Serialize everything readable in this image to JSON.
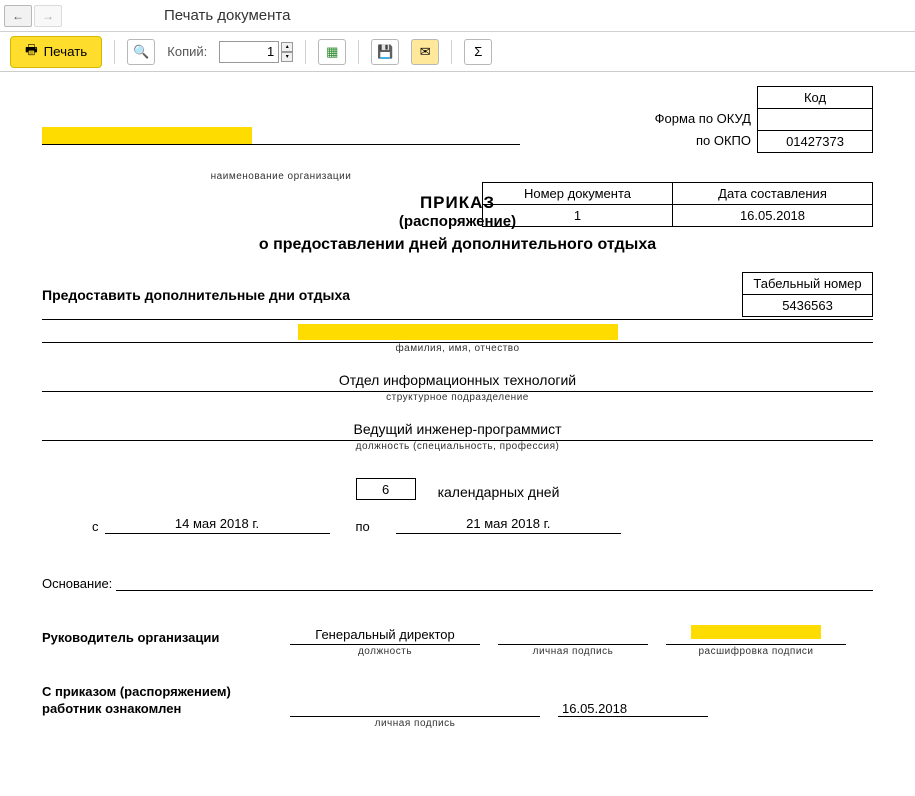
{
  "window": {
    "title": "Печать документа"
  },
  "toolbar": {
    "print": "Печать",
    "copies_label": "Копий:",
    "copies_value": "1"
  },
  "form": {
    "okud_label": "Форма по ОКУД",
    "okpo_label": "по ОКПО",
    "code_header": "Код",
    "okud_value": "",
    "okpo_value": "01427373",
    "org_caption": "наименование организации",
    "num_header": "Номер документа",
    "date_header": "Дата составления",
    "doc_number": "1",
    "doc_date": "16.05.2018",
    "title1": "ПРИКАЗ",
    "title2": "(распоряжение)",
    "title3": "о предоставлении дней дополнительного отдыха",
    "grant_text": "Предоставить дополнительные дни отдыха",
    "tab_header": "Табельный номер",
    "tab_value": "5436563",
    "fio_caption": "фамилия, имя, отчество",
    "dept_value": "Отдел информационных технологий",
    "dept_caption": "структурное подразделение",
    "position_value": "Ведущий инженер-программист",
    "position_caption": "должность (специальность, профессия)",
    "days_value": "6",
    "days_label": "календарных дней",
    "date_from_label": "с",
    "date_from": "14 мая 2018 г.",
    "date_to_label": "по",
    "date_to": "21 мая 2018 г.",
    "basis_label": "Основание:",
    "head_label": "Руководитель организации",
    "head_position": "Генеральный директор",
    "cap_position": "должность",
    "cap_sign": "личная подпись",
    "cap_name": "расшифровка подписи",
    "ack_label1": "С приказом (распоряжением)",
    "ack_label2": "работник  ознакомлен",
    "ack_date": "16.05.2018"
  }
}
